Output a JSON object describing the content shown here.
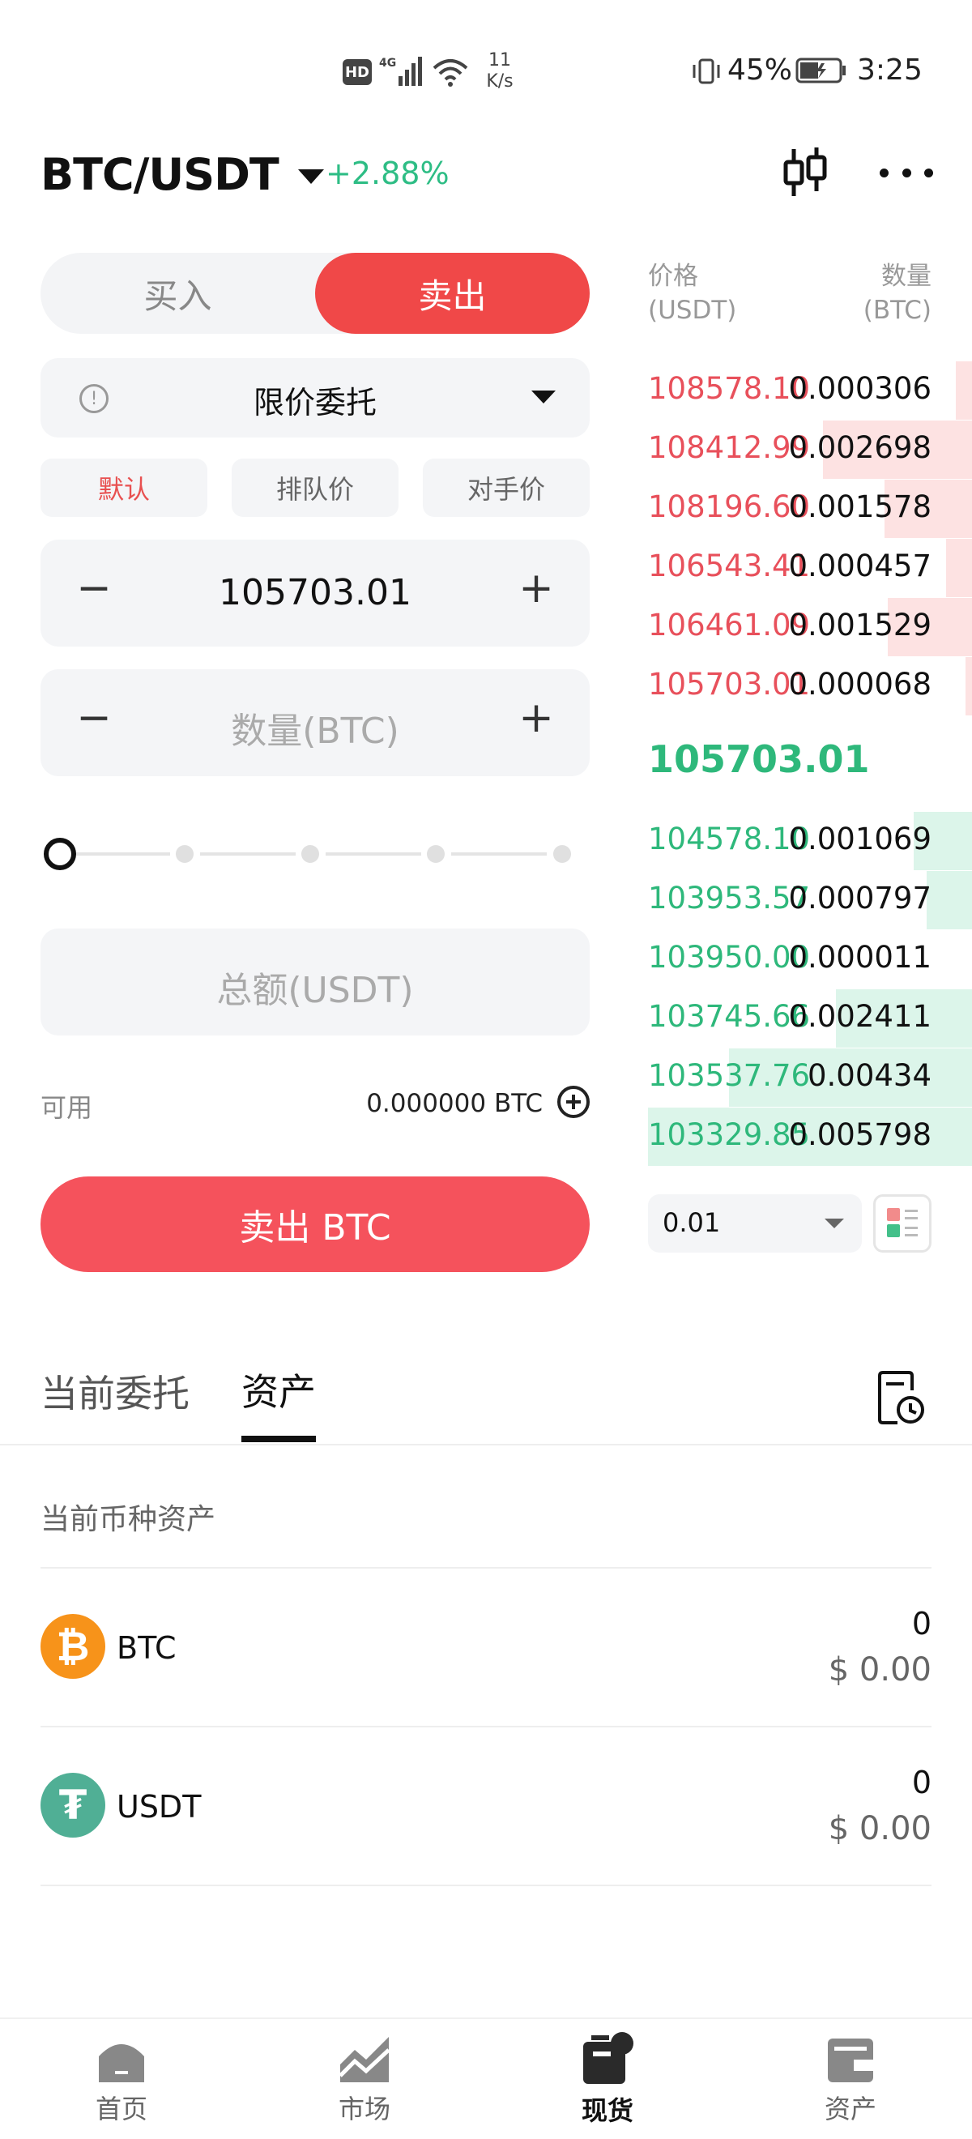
{
  "status_bar": {
    "network": "HD 4G",
    "speed_value": "11",
    "speed_unit": "K/s",
    "battery": "45%",
    "time": "3:25"
  },
  "header": {
    "pair": "BTC/USDT",
    "change": "+2.88%"
  },
  "trade_panel": {
    "buy_label": "买入",
    "sell_label": "卖出",
    "order_type": "限价委托",
    "chips": [
      "默认",
      "排队价",
      "对手价"
    ],
    "price_value": "105703.01",
    "amount_placeholder": "数量(BTC)",
    "total_placeholder": "总额(USDT)",
    "available_label": "可用",
    "available_value": "0.000000 BTC",
    "submit_label": "卖出 BTC",
    "slider_percent": 0
  },
  "order_book": {
    "price_header": "价格",
    "price_unit": "(USDT)",
    "qty_header": "数量",
    "qty_unit": "(BTC)",
    "asks": [
      {
        "price": "108578.10",
        "qty": "0.000306",
        "depth": 0.05
      },
      {
        "price": "108412.99",
        "qty": "0.002698",
        "depth": 0.46
      },
      {
        "price": "108196.60",
        "qty": "0.001578",
        "depth": 0.27
      },
      {
        "price": "106543.41",
        "qty": "0.000457",
        "depth": 0.08
      },
      {
        "price": "106461.09",
        "qty": "0.001529",
        "depth": 0.26
      },
      {
        "price": "105703.01",
        "qty": "0.000068",
        "depth": 0.02
      }
    ],
    "last_price": "105703.01",
    "bids": [
      {
        "price": "104578.10",
        "qty": "0.001069",
        "depth": 0.18
      },
      {
        "price": "103953.57",
        "qty": "0.000797",
        "depth": 0.14
      },
      {
        "price": "103950.00",
        "qty": "0.000011",
        "depth": 0.0
      },
      {
        "price": "103745.66",
        "qty": "0.002411",
        "depth": 0.42
      },
      {
        "price": "103537.76",
        "qty": "0.00434",
        "depth": 0.75
      },
      {
        "price": "103329.85",
        "qty": "0.005798",
        "depth": 1.0
      }
    ],
    "precision": "0.01"
  },
  "tabs": {
    "open_orders": "当前委托",
    "assets": "资产"
  },
  "assets": {
    "section_title": "当前币种资产",
    "items": [
      {
        "symbol": "BTC",
        "amount": "0",
        "value": "$ 0.00",
        "icon_glyph": "₿",
        "color": "#f7931a"
      },
      {
        "symbol": "USDT",
        "amount": "0",
        "value": "$ 0.00",
        "icon_glyph": "₮",
        "color": "#50af95"
      }
    ]
  },
  "bottom_nav": {
    "home": "首页",
    "market": "市场",
    "spot": "现货",
    "assets": "资产"
  },
  "colors": {
    "sell_red": "#f04848",
    "ask_red": "#e8505b",
    "bid_green": "#2eb87b",
    "change_green": "#2ebd85"
  }
}
